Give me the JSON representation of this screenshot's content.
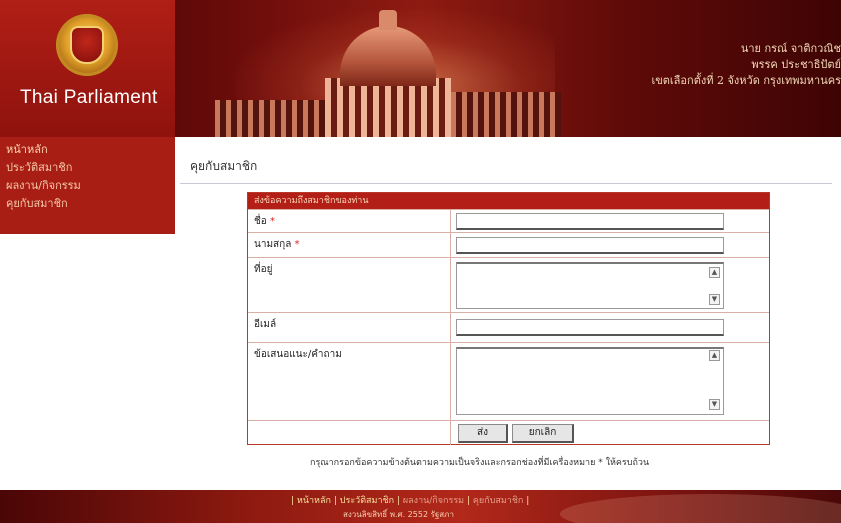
{
  "header": {
    "site_title": "Thai Parliament",
    "member_name": "นาย กรณ์ จาติกวณิช",
    "party": "พรรค ประชาธิปัตย์",
    "constituency": "เขตเลือกตั้งที่ 2 จังหวัด กรุงเทพมหานคร"
  },
  "sidebar": {
    "items": [
      {
        "label": "หน้าหลัก"
      },
      {
        "label": "ประวัติสมาชิก"
      },
      {
        "label": "ผลงาน/กิจกรรม"
      },
      {
        "label": "คุยกับสมาชิก"
      }
    ]
  },
  "main": {
    "heading": "คุยกับสมาชิก"
  },
  "form": {
    "header": "ส่งข้อความถึงสมาชิกของท่าน",
    "fields": {
      "name_label": "ชื่อ",
      "surname_label": "นามสกุล",
      "address_label": "ที่อยู่",
      "email_label": "อีเมล์",
      "comment_label": "ข้อเสนอแนะ/คำถาม",
      "required_mark": "*"
    },
    "values": {
      "name": "",
      "surname": "",
      "address": "",
      "email": "",
      "comment": ""
    },
    "submit_label": "ส่ง",
    "cancel_label": "ยกเลิก",
    "note": "กรุณากรอกข้อความข้างต้นตามความเป็นจริงและกรอกช่องที่มีเครื่องหมาย * ให้ครบถ้วน"
  },
  "footer": {
    "nav": [
      {
        "label": "หน้าหลัก"
      },
      {
        "label": "ประวัติสมาชิก"
      },
      {
        "label": "ผลงาน/กิจกรรม"
      },
      {
        "label": "คุยกับสมาชิก"
      }
    ],
    "separator": "|",
    "copyright": "สงวนลิขสิทธิ์ พ.ศ. 2552 รัฐสภา"
  },
  "colors": {
    "brand_red": "#a81d14",
    "form_header": "#b31f16",
    "required": "#dd2222"
  },
  "icons": {
    "emblem": "parliament-emblem-icon",
    "scroll_up": "scroll-up-icon",
    "scroll_down": "scroll-down-icon"
  }
}
